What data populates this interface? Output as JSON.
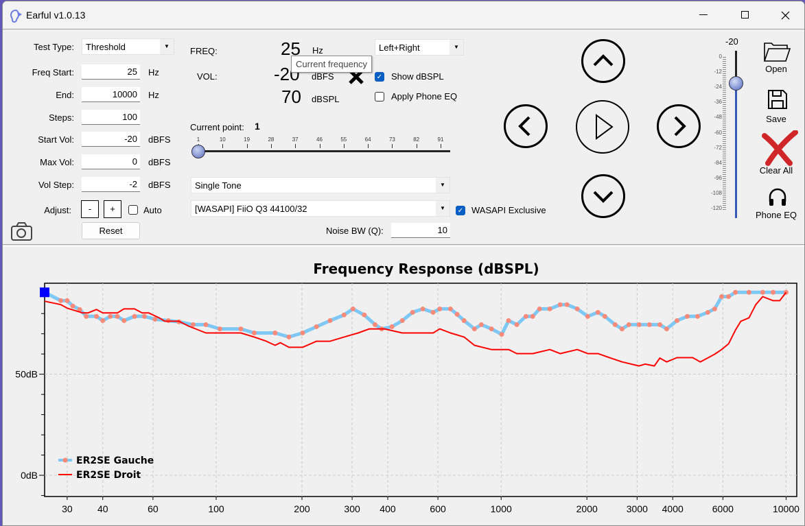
{
  "window": {
    "title": "Earful v1.0.13",
    "controls": [
      "minimize-icon",
      "maximize-icon",
      "close-icon"
    ]
  },
  "settings": {
    "test_type_label": "Test Type:",
    "test_type": "Threshold",
    "freq_start_label": "Freq Start:",
    "freq_start": "25",
    "freq_start_unit": "Hz",
    "end_label": "End:",
    "end": "10000",
    "end_unit": "Hz",
    "steps_label": "Steps:",
    "steps": "100",
    "start_vol_label": "Start Vol:",
    "start_vol": "-20",
    "start_vol_unit": "dBFS",
    "max_vol_label": "Max Vol:",
    "max_vol": "0",
    "max_vol_unit": "dBFS",
    "vol_step_label": "Vol Step:",
    "vol_step": "-2",
    "vol_step_unit": "dBFS",
    "adjust_label": "Adjust:",
    "minus": "-",
    "plus": "+",
    "auto_label": "Auto",
    "auto_checked": false,
    "reset_label": "Reset"
  },
  "readout": {
    "freq_label": "FREQ:",
    "freq": "25",
    "freq_unit": "Hz",
    "vol_label": "VOL:",
    "vol": "-20",
    "vol_unit": "dBFS",
    "spl": "70",
    "spl_unit": "dBSPL",
    "tooltip": "Current frequency",
    "channel": "Left+Right",
    "show_dbspl_label": "Show dBSPL",
    "show_dbspl": true,
    "apply_eq_label": "Apply Phone EQ",
    "apply_eq": false
  },
  "point": {
    "label": "Current point:",
    "value": "1",
    "ticks": [
      "1",
      "10",
      "19",
      "28",
      "37",
      "46",
      "55",
      "64",
      "73",
      "82",
      "91"
    ],
    "position": 1,
    "min": 1,
    "max": 100
  },
  "signal": {
    "type": "Single Tone",
    "device": "[WASAPI] FiiO Q3 44100/32",
    "wasapi_exclusive_label": "WASAPI Exclusive",
    "wasapi_exclusive": true,
    "noise_bw_label": "Noise BW (Q):",
    "noise_bw": "10"
  },
  "volume_slider": {
    "value": "-20",
    "scale": [
      "0",
      "-12",
      "-24",
      "-36",
      "-48",
      "-60",
      "-72",
      "-84",
      "-96",
      "-108",
      "-120"
    ],
    "level": -20
  },
  "actions": {
    "open": "Open",
    "save": "Save",
    "clear": "Clear All",
    "phone_eq": "Phone EQ"
  },
  "colors": {
    "accent": "#0a5fc4",
    "gauche_line": "#7ec8f5",
    "gauche_marker": "#f88a7a",
    "droit": "#ff0000",
    "current_marker": "#0000ff",
    "clear": "#d0262a"
  },
  "chart_data": {
    "type": "line",
    "title": "Frequency Response (dBSPL)",
    "x_scale": "log",
    "xlim": [
      25,
      10900
    ],
    "ylim": [
      -10.5,
      95
    ],
    "x_ticks": [
      30,
      40,
      60,
      100,
      200,
      300,
      400,
      600,
      1000,
      2000,
      3000,
      4000,
      6000,
      10000
    ],
    "x_tick_labels": [
      "30",
      "40",
      "60",
      "100",
      "200",
      "300",
      "400",
      "600",
      "1000",
      "2000",
      "3000",
      "4000",
      "6000",
      "10000"
    ],
    "y_ticks": [
      0,
      50
    ],
    "y_tick_labels": [
      "0dB",
      "50dB"
    ],
    "y_minor_ticks": [
      -10,
      10,
      20,
      30,
      40,
      60,
      70,
      80,
      90
    ],
    "grid": true,
    "legend": "bottom-left",
    "current_point": [
      25,
      90.5
    ],
    "series": [
      {
        "name": "ER2SE Gauche",
        "markers": true,
        "points": [
          [
            25,
            90.5
          ],
          [
            28.5,
            86.4
          ],
          [
            30,
            86.4
          ],
          [
            31.4,
            83.7
          ],
          [
            33.2,
            82
          ],
          [
            35,
            78.6
          ],
          [
            38,
            78.6
          ],
          [
            40,
            76.5
          ],
          [
            42.5,
            78.6
          ],
          [
            45,
            78.6
          ],
          [
            47.5,
            76.5
          ],
          [
            51.7,
            78.6
          ],
          [
            56,
            78.6
          ],
          [
            61,
            77.2
          ],
          [
            68,
            76.5
          ],
          [
            74,
            75.9
          ],
          [
            83,
            74.5
          ],
          [
            92,
            74.5
          ],
          [
            103,
            72.4
          ],
          [
            122,
            72.4
          ],
          [
            136,
            70.4
          ],
          [
            161,
            70.4
          ],
          [
            180,
            68.4
          ],
          [
            201,
            70.4
          ],
          [
            225,
            73.5
          ],
          [
            251,
            76.5
          ],
          [
            281,
            79.3
          ],
          [
            302,
            82.3
          ],
          [
            331,
            79.3
          ],
          [
            361,
            74.5
          ],
          [
            381,
            72.4
          ],
          [
            414,
            73.5
          ],
          [
            450,
            76.5
          ],
          [
            489,
            80.6
          ],
          [
            531,
            82.3
          ],
          [
            577,
            80.6
          ],
          [
            609,
            82.3
          ],
          [
            664,
            82.3
          ],
          [
            701,
            79.6
          ],
          [
            741,
            76.5
          ],
          [
            806,
            72.4
          ],
          [
            852,
            74.5
          ],
          [
            925,
            72.4
          ],
          [
            1005,
            69.7
          ],
          [
            1062,
            76.5
          ],
          [
            1135,
            74.5
          ],
          [
            1222,
            78.6
          ],
          [
            1291,
            78.6
          ],
          [
            1364,
            82.3
          ],
          [
            1482,
            82.3
          ],
          [
            1611,
            84.4
          ],
          [
            1703,
            84.4
          ],
          [
            1850,
            82.3
          ],
          [
            2013,
            78.6
          ],
          [
            2187,
            80.6
          ],
          [
            2312,
            78.6
          ],
          [
            2512,
            74.5
          ],
          [
            2656,
            72.4
          ],
          [
            2806,
            74.5
          ],
          [
            3049,
            74.5
          ],
          [
            3313,
            74.5
          ],
          [
            3606,
            74.5
          ],
          [
            3810,
            72.4
          ],
          [
            4141,
            76.5
          ],
          [
            4500,
            78.6
          ],
          [
            4890,
            78.6
          ],
          [
            5313,
            80.6
          ],
          [
            5617,
            82.3
          ],
          [
            5940,
            88.4
          ],
          [
            6280,
            88.4
          ],
          [
            6640,
            90.5
          ],
          [
            7410,
            90.5
          ],
          [
            8280,
            90.5
          ],
          [
            9000,
            90.5
          ],
          [
            10000,
            90.5
          ]
        ]
      },
      {
        "name": "ER2SE Droit",
        "markers": false,
        "points": [
          [
            25,
            86.1
          ],
          [
            28.5,
            84.4
          ],
          [
            30,
            82.7
          ],
          [
            34,
            80.3
          ],
          [
            35.5,
            80.3
          ],
          [
            38,
            82
          ],
          [
            40,
            80.3
          ],
          [
            45,
            80.3
          ],
          [
            47.5,
            82.3
          ],
          [
            51.7,
            82.3
          ],
          [
            55,
            80.3
          ],
          [
            58,
            80.3
          ],
          [
            63,
            77.9
          ],
          [
            66,
            76.2
          ],
          [
            74,
            76.2
          ],
          [
            80,
            73.8
          ],
          [
            92,
            70.4
          ],
          [
            103,
            70.4
          ],
          [
            122,
            70.4
          ],
          [
            136,
            68.4
          ],
          [
            150,
            66.3
          ],
          [
            161,
            64.3
          ],
          [
            168,
            65.6
          ],
          [
            180,
            63.3
          ],
          [
            201,
            63.3
          ],
          [
            225,
            66.3
          ],
          [
            251,
            66.3
          ],
          [
            281,
            68.4
          ],
          [
            315,
            70.4
          ],
          [
            345,
            72.4
          ],
          [
            390,
            72.4
          ],
          [
            450,
            70.4
          ],
          [
            489,
            70.4
          ],
          [
            577,
            70.4
          ],
          [
            609,
            72.4
          ],
          [
            664,
            70.4
          ],
          [
            741,
            68.4
          ],
          [
            806,
            64.3
          ],
          [
            925,
            62.2
          ],
          [
            1062,
            62.2
          ],
          [
            1135,
            60.2
          ],
          [
            1291,
            60.2
          ],
          [
            1482,
            62.2
          ],
          [
            1611,
            60.2
          ],
          [
            1850,
            62.2
          ],
          [
            2013,
            60.2
          ],
          [
            2187,
            60.2
          ],
          [
            2400,
            58.2
          ],
          [
            2656,
            56.1
          ],
          [
            3049,
            54.1
          ],
          [
            3200,
            55
          ],
          [
            3450,
            54.1
          ],
          [
            3606,
            58
          ],
          [
            3810,
            56.1
          ],
          [
            4141,
            58.2
          ],
          [
            4700,
            58.2
          ],
          [
            5000,
            56.1
          ],
          [
            5617,
            59.9
          ],
          [
            5940,
            62.2
          ],
          [
            6280,
            65
          ],
          [
            6640,
            71.8
          ],
          [
            6935,
            76.2
          ],
          [
            7410,
            77.9
          ],
          [
            7830,
            84.4
          ],
          [
            8280,
            88.4
          ],
          [
            9000,
            86.4
          ],
          [
            9500,
            86.4
          ],
          [
            10000,
            90.5
          ]
        ]
      }
    ]
  }
}
